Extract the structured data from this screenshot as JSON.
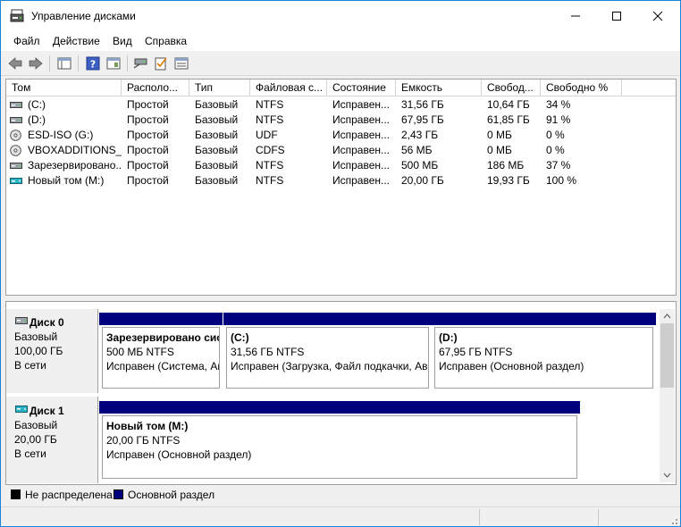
{
  "window": {
    "title": "Управление дисками",
    "menu": [
      "Файл",
      "Действие",
      "Вид",
      "Справка"
    ]
  },
  "toolbar": {
    "icons": [
      "back-icon",
      "forward-icon",
      "console-tree-icon",
      "help-icon",
      "properties-icon",
      "connect-disk-icon",
      "check-icon",
      "list-view-icon"
    ]
  },
  "volumes": {
    "columns": [
      "Том",
      "Располо...",
      "Тип",
      "Файловая с...",
      "Состояние",
      "Емкость",
      "Свобод...",
      "Свободно %"
    ],
    "rows": [
      {
        "name": "(C:)",
        "layout": "Простой",
        "type": "Базовый",
        "fs": "NTFS",
        "status": "Исправен...",
        "capacity": "31,56 ГБ",
        "free": "10,64 ГБ",
        "free_pct": "34 %",
        "icon": "hdd-icon"
      },
      {
        "name": "(D:)",
        "layout": "Простой",
        "type": "Базовый",
        "fs": "NTFS",
        "status": "Исправен...",
        "capacity": "67,95 ГБ",
        "free": "61,85 ГБ",
        "free_pct": "91 %",
        "icon": "hdd-icon"
      },
      {
        "name": "ESD-ISO (G:)",
        "layout": "Простой",
        "type": "Базовый",
        "fs": "UDF",
        "status": "Исправен...",
        "capacity": "2,43 ГБ",
        "free": "0 МБ",
        "free_pct": "0 %",
        "icon": "cd-icon"
      },
      {
        "name": "VBOXADDITIONS_...",
        "layout": "Простой",
        "type": "Базовый",
        "fs": "CDFS",
        "status": "Исправен...",
        "capacity": "56 МБ",
        "free": "0 МБ",
        "free_pct": "0 %",
        "icon": "cd-icon"
      },
      {
        "name": "Зарезервировано...",
        "layout": "Простой",
        "type": "Базовый",
        "fs": "NTFS",
        "status": "Исправен...",
        "capacity": "500 МБ",
        "free": "186 МБ",
        "free_pct": "37 %",
        "icon": "hdd-icon"
      },
      {
        "name": "Новый том (M:)",
        "layout": "Простой",
        "type": "Базовый",
        "fs": "NTFS",
        "status": "Исправен...",
        "capacity": "20,00 ГБ",
        "free": "19,93 ГБ",
        "free_pct": "100 %",
        "icon": "vhd-icon"
      }
    ]
  },
  "disks": [
    {
      "name": "Диск 0",
      "type": "Базовый",
      "size": "100,00 ГБ",
      "status": "В сети",
      "partitions": [
        {
          "name": "Зарезервировано системой",
          "size": "500 МБ NTFS",
          "status": "Исправен (Система, Активен, Основной раздел)"
        },
        {
          "name": "(C:)",
          "size": "31,56 ГБ NTFS",
          "status": "Исправен (Загрузка, Файл подкачки, Аварийный дамп, Основной раздел)"
        },
        {
          "name": "(D:)",
          "size": "67,95 ГБ NTFS",
          "status": "Исправен (Основной раздел)"
        }
      ]
    },
    {
      "name": "Диск 1",
      "type": "Базовый",
      "size": "20,00 ГБ",
      "status": "В сети",
      "partitions": [
        {
          "name": "Новый том  (M:)",
          "size": "20,00 ГБ NTFS",
          "status": "Исправен (Основной раздел)"
        }
      ]
    }
  ],
  "legend": [
    {
      "label": "Не распределена",
      "color": "#000000"
    },
    {
      "label": "Основной раздел",
      "color": "#00007f"
    }
  ],
  "colors": {
    "primary_partition": "#00007f",
    "unallocated": "#000000",
    "window_border": "#1883d7"
  }
}
